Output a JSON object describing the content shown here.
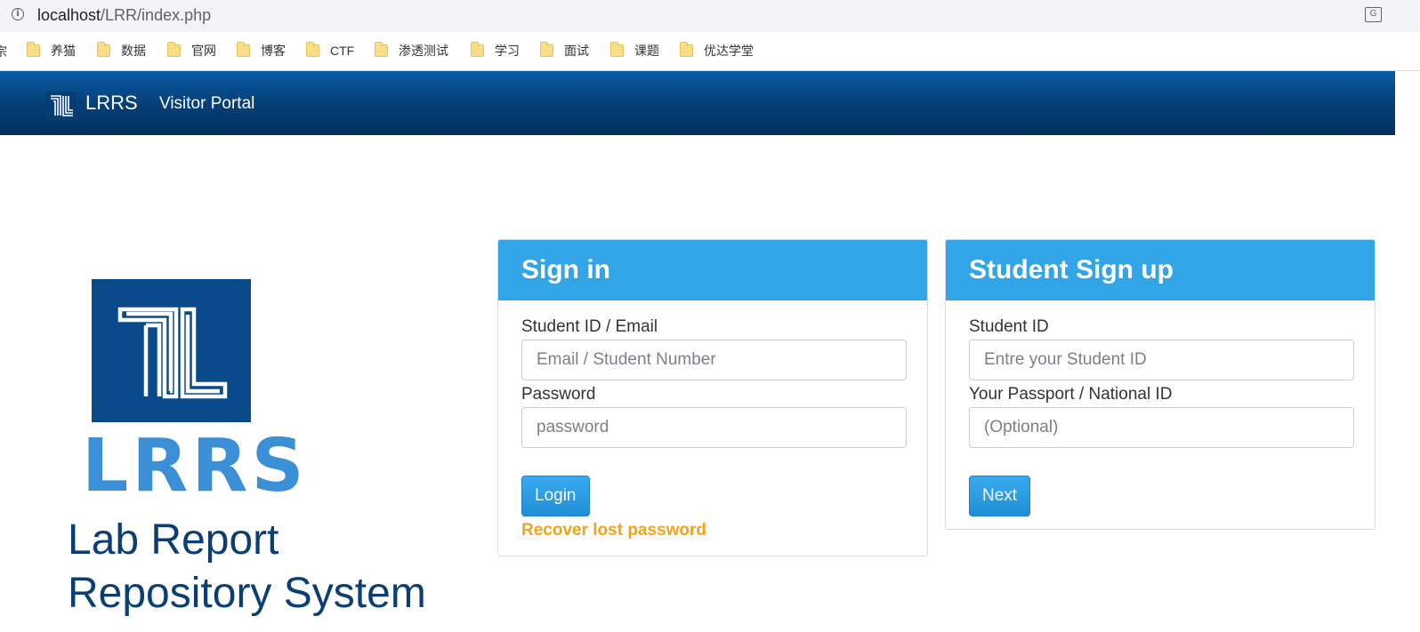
{
  "browser": {
    "url_host": "localhost",
    "url_path": "/LRR/index.php",
    "bookmark_cut": "宗",
    "bookmarks": [
      "养猫",
      "数据",
      "官网",
      "博客",
      "CTF",
      "渗透测试",
      "学习",
      "面试",
      "课题",
      "优达学堂"
    ]
  },
  "navbar": {
    "brand": "LRRS",
    "portal_link": "Visitor Portal"
  },
  "hero": {
    "logo_word": "LRRS",
    "tagline_line1": "Lab Report",
    "tagline_line2": "Repository System"
  },
  "signin": {
    "title": "Sign in",
    "id_label": "Student ID / Email",
    "id_placeholder": "Email / Student Number",
    "id_value": "",
    "password_label": "Password",
    "password_placeholder": "password",
    "password_value": "",
    "login_button": "Login",
    "recover_link": "Recover lost password"
  },
  "signup": {
    "title": "Student Sign up",
    "id_label": "Student ID",
    "id_placeholder": "Entre your Student ID",
    "id_value": "",
    "passport_label": "Your Passport / National ID",
    "passport_placeholder": "(Optional)",
    "passport_value": "",
    "next_button": "Next"
  },
  "colors": {
    "navbar": "#053e76",
    "panel_header": "#32a5e6",
    "button": "#2a9be0",
    "recover_link": "#f0a31c",
    "tagline": "#0b3f73",
    "logo_box": "#0a4a8a",
    "logo_word": "#3b8fd6"
  }
}
